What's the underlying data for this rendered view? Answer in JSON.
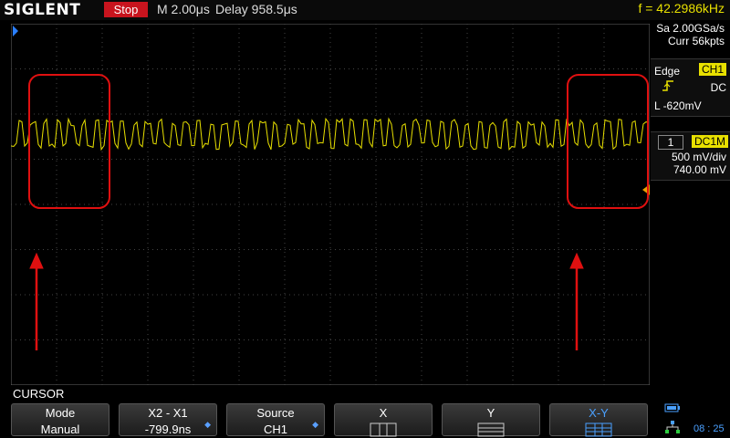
{
  "header": {
    "brand": "SIGLENT",
    "run_state": "Stop",
    "timebase": "M 2.00μs",
    "delay": "Delay 958.5μs",
    "frequency": "f = 42.2986kHz"
  },
  "acquisition": {
    "sample_rate": "Sa 2.00GSa/s",
    "memory": "Curr 56kpts"
  },
  "trigger": {
    "type": "Edge",
    "source": "CH1",
    "coupling": "DC",
    "level": "L  -620mV"
  },
  "channel": {
    "number": "1",
    "coupling_badge": "DC1M",
    "scale": "500 mV/div",
    "offset": "740.00 mV"
  },
  "waveform": {
    "channel_marker": "1",
    "color": "#e8e000"
  },
  "annotations": {
    "color": "#e01010"
  },
  "menu": {
    "title": "CURSOR",
    "keys": [
      {
        "label": "Mode",
        "value": "Manual"
      },
      {
        "label": "X2 - X1",
        "value": "-799.9ns"
      },
      {
        "label": "Source",
        "value": "CH1"
      },
      {
        "label": "X",
        "value": ""
      },
      {
        "label": "Y",
        "value": ""
      },
      {
        "label": "X-Y",
        "value": ""
      }
    ]
  },
  "status": {
    "time": "08 : 25"
  }
}
